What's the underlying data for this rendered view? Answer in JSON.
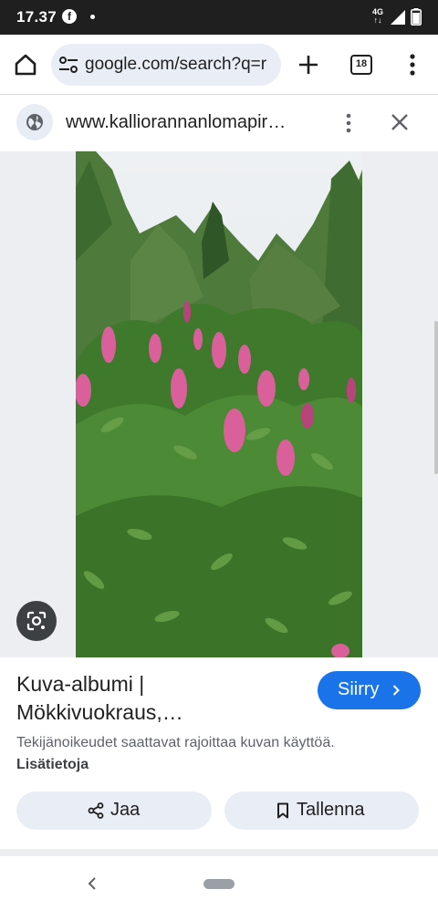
{
  "status_bar": {
    "time": "17.37",
    "network": "4G",
    "battery_level": "82",
    "icons": [
      "facebook-icon",
      "notification-dot-icon",
      "signal-icon",
      "battery-icon"
    ]
  },
  "browser": {
    "url": "google.com/search?q=r",
    "tab_count": "18",
    "icons": [
      "home-icon",
      "site-settings-icon",
      "new-tab-icon",
      "tab-switcher-icon",
      "overflow-menu-icon"
    ]
  },
  "source": {
    "domain": "www.kalliorannanlomapir…",
    "icons": [
      "globe-icon",
      "more-vert-icon",
      "close-icon"
    ]
  },
  "image": {
    "description_icon": "google-lens-icon",
    "colors": {
      "sky": "#e8ecef",
      "foliage": "#3f7a2c",
      "flower": "#d9609a"
    }
  },
  "result": {
    "title_line1": "Kuva-albumi |",
    "title_line2": "Mökkivuokraus,…",
    "go_label": "Siirry",
    "copyright_text": "Tekijänoikeudet saattavat rajoittaa kuvan käyttöä.",
    "more_info_label": "Lisätietoja",
    "share_label": "Jaa",
    "save_label": "Tallenna"
  },
  "colors": {
    "accent": "#1a73e8",
    "pill_bg": "#e9eef6",
    "status_bar_bg": "#1f1f1f"
  }
}
